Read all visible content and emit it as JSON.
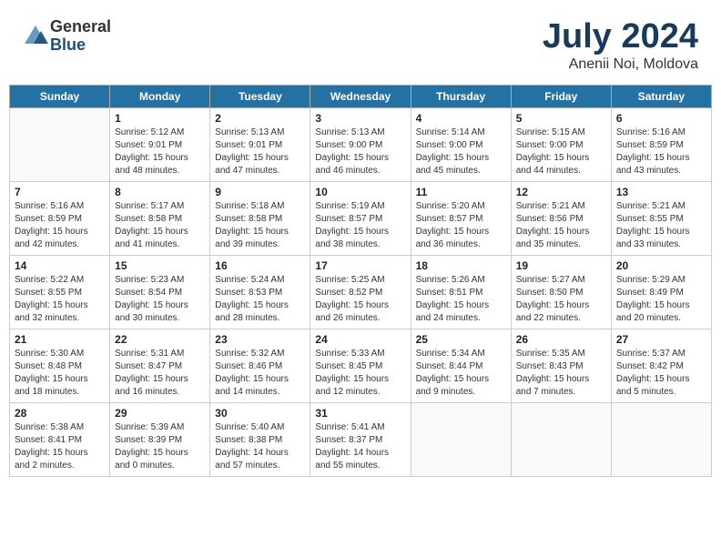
{
  "header": {
    "logo_general": "General",
    "logo_blue": "Blue",
    "month": "July 2024",
    "location": "Anenii Noi, Moldova"
  },
  "days_of_week": [
    "Sunday",
    "Monday",
    "Tuesday",
    "Wednesday",
    "Thursday",
    "Friday",
    "Saturday"
  ],
  "weeks": [
    [
      {
        "day": "",
        "empty": true
      },
      {
        "day": "1",
        "sunrise": "5:12 AM",
        "sunset": "9:01 PM",
        "daylight": "15 hours and 48 minutes."
      },
      {
        "day": "2",
        "sunrise": "5:13 AM",
        "sunset": "9:01 PM",
        "daylight": "15 hours and 47 minutes."
      },
      {
        "day": "3",
        "sunrise": "5:13 AM",
        "sunset": "9:00 PM",
        "daylight": "15 hours and 46 minutes."
      },
      {
        "day": "4",
        "sunrise": "5:14 AM",
        "sunset": "9:00 PM",
        "daylight": "15 hours and 45 minutes."
      },
      {
        "day": "5",
        "sunrise": "5:15 AM",
        "sunset": "9:00 PM",
        "daylight": "15 hours and 44 minutes."
      },
      {
        "day": "6",
        "sunrise": "5:16 AM",
        "sunset": "8:59 PM",
        "daylight": "15 hours and 43 minutes."
      }
    ],
    [
      {
        "day": "7",
        "sunrise": "5:16 AM",
        "sunset": "8:59 PM",
        "daylight": "15 hours and 42 minutes."
      },
      {
        "day": "8",
        "sunrise": "5:17 AM",
        "sunset": "8:58 PM",
        "daylight": "15 hours and 41 minutes."
      },
      {
        "day": "9",
        "sunrise": "5:18 AM",
        "sunset": "8:58 PM",
        "daylight": "15 hours and 39 minutes."
      },
      {
        "day": "10",
        "sunrise": "5:19 AM",
        "sunset": "8:57 PM",
        "daylight": "15 hours and 38 minutes."
      },
      {
        "day": "11",
        "sunrise": "5:20 AM",
        "sunset": "8:57 PM",
        "daylight": "15 hours and 36 minutes."
      },
      {
        "day": "12",
        "sunrise": "5:21 AM",
        "sunset": "8:56 PM",
        "daylight": "15 hours and 35 minutes."
      },
      {
        "day": "13",
        "sunrise": "5:21 AM",
        "sunset": "8:55 PM",
        "daylight": "15 hours and 33 minutes."
      }
    ],
    [
      {
        "day": "14",
        "sunrise": "5:22 AM",
        "sunset": "8:55 PM",
        "daylight": "15 hours and 32 minutes."
      },
      {
        "day": "15",
        "sunrise": "5:23 AM",
        "sunset": "8:54 PM",
        "daylight": "15 hours and 30 minutes."
      },
      {
        "day": "16",
        "sunrise": "5:24 AM",
        "sunset": "8:53 PM",
        "daylight": "15 hours and 28 minutes."
      },
      {
        "day": "17",
        "sunrise": "5:25 AM",
        "sunset": "8:52 PM",
        "daylight": "15 hours and 26 minutes."
      },
      {
        "day": "18",
        "sunrise": "5:26 AM",
        "sunset": "8:51 PM",
        "daylight": "15 hours and 24 minutes."
      },
      {
        "day": "19",
        "sunrise": "5:27 AM",
        "sunset": "8:50 PM",
        "daylight": "15 hours and 22 minutes."
      },
      {
        "day": "20",
        "sunrise": "5:29 AM",
        "sunset": "8:49 PM",
        "daylight": "15 hours and 20 minutes."
      }
    ],
    [
      {
        "day": "21",
        "sunrise": "5:30 AM",
        "sunset": "8:48 PM",
        "daylight": "15 hours and 18 minutes."
      },
      {
        "day": "22",
        "sunrise": "5:31 AM",
        "sunset": "8:47 PM",
        "daylight": "15 hours and 16 minutes."
      },
      {
        "day": "23",
        "sunrise": "5:32 AM",
        "sunset": "8:46 PM",
        "daylight": "15 hours and 14 minutes."
      },
      {
        "day": "24",
        "sunrise": "5:33 AM",
        "sunset": "8:45 PM",
        "daylight": "15 hours and 12 minutes."
      },
      {
        "day": "25",
        "sunrise": "5:34 AM",
        "sunset": "8:44 PM",
        "daylight": "15 hours and 9 minutes."
      },
      {
        "day": "26",
        "sunrise": "5:35 AM",
        "sunset": "8:43 PM",
        "daylight": "15 hours and 7 minutes."
      },
      {
        "day": "27",
        "sunrise": "5:37 AM",
        "sunset": "8:42 PM",
        "daylight": "15 hours and 5 minutes."
      }
    ],
    [
      {
        "day": "28",
        "sunrise": "5:38 AM",
        "sunset": "8:41 PM",
        "daylight": "15 hours and 2 minutes."
      },
      {
        "day": "29",
        "sunrise": "5:39 AM",
        "sunset": "8:39 PM",
        "daylight": "15 hours and 0 minutes."
      },
      {
        "day": "30",
        "sunrise": "5:40 AM",
        "sunset": "8:38 PM",
        "daylight": "14 hours and 57 minutes."
      },
      {
        "day": "31",
        "sunrise": "5:41 AM",
        "sunset": "8:37 PM",
        "daylight": "14 hours and 55 minutes."
      },
      {
        "day": "",
        "empty": true
      },
      {
        "day": "",
        "empty": true
      },
      {
        "day": "",
        "empty": true
      }
    ]
  ]
}
